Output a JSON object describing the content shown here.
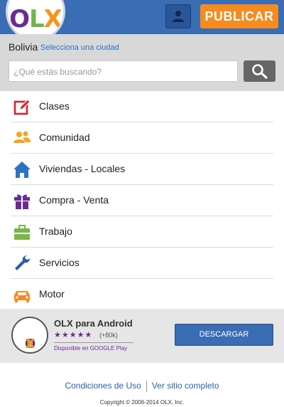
{
  "header": {
    "logo_text": [
      "O",
      "L",
      "X"
    ],
    "publish_label": "PUBLICAR",
    "user_icon": "user-icon"
  },
  "location": {
    "country": "Bolivia",
    "select_city": "Selecciona una ciudad"
  },
  "search": {
    "placeholder": "¿Qué estás buscando?",
    "button_icon": "search-icon"
  },
  "categories": [
    {
      "label": "Clases",
      "icon": "pencil-square-icon",
      "color": "#d8232a"
    },
    {
      "label": "Comunidad",
      "icon": "people-icon",
      "color": "#f5a623"
    },
    {
      "label": "Viviendas - Locales",
      "icon": "house-icon",
      "color": "#2a73c5"
    },
    {
      "label": "Compra - Venta",
      "icon": "gift-icon",
      "color": "#6b2c91"
    },
    {
      "label": "Trabajo",
      "icon": "briefcase-icon",
      "color": "#7ab648"
    },
    {
      "label": "Servicios",
      "icon": "wrench-icon",
      "color": "#2a5fa8"
    },
    {
      "label": "Motor",
      "icon": "car-icon",
      "color": "#f68b1f"
    }
  ],
  "app_promo": {
    "title": "OLX para Android",
    "stars": "★★★★★",
    "rating_count": "(+80k)",
    "store": "Disponible en GOOGLE Play",
    "download_label": "DESCARGAR"
  },
  "footer": {
    "terms": "Condiciones de Uso",
    "full_site": "Ver sitio completo",
    "copyright": "Copyright © 2006-2014 OLX, Inc."
  },
  "colors": {
    "brand_blue": "#3a6db4",
    "brand_orange": "#f68b1f",
    "brand_purple": "#6b2c91",
    "brand_green": "#6fb64b"
  }
}
